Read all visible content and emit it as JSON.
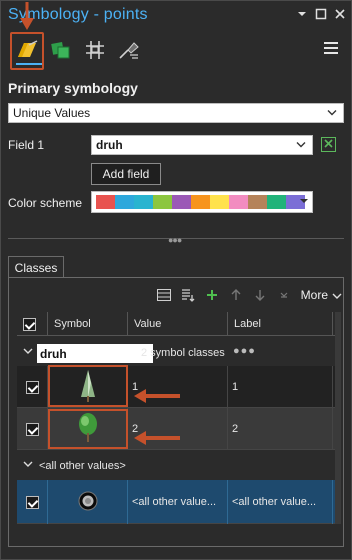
{
  "window": {
    "title": "Symbology - points",
    "buttons": [
      "chevron-down-icon",
      "maximize-icon",
      "close-icon"
    ]
  },
  "tab_icons": [
    {
      "name": "primary-symbology-tab",
      "icon": "paintbrush-icon",
      "active": true
    },
    {
      "name": "vary-symbology-tab",
      "icon": "layers-icon",
      "active": false
    },
    {
      "name": "symbol-layers-tab",
      "icon": "grid-icon",
      "active": false
    },
    {
      "name": "label-classes-tab",
      "icon": "label-icon",
      "active": false
    }
  ],
  "primary": {
    "heading": "Primary symbology",
    "renderer": "Unique Values"
  },
  "field": {
    "label": "Field 1",
    "value": "druh",
    "add_field_label": "Add field"
  },
  "color_scheme": {
    "label": "Color scheme",
    "colors": [
      "#e8534f",
      "#2ea8dc",
      "#29b4d0",
      "#8cc63f",
      "#9b59b6",
      "#f7941d",
      "#ffe24d",
      "#f28cc0",
      "#b5835a",
      "#21b37a",
      "#7b6ed6"
    ]
  },
  "classes_tab": {
    "label": "Classes"
  },
  "toolbar": {
    "more_label": "More"
  },
  "grid": {
    "headers": {
      "symbol": "Symbol",
      "value": "Value",
      "label": "Label"
    },
    "group": {
      "field": "druh",
      "summary": "2 symbol classes",
      "dots": "●●●"
    },
    "rows": [
      {
        "value": "1",
        "label": "1",
        "symbol": "conifer-tree-icon"
      },
      {
        "value": "2",
        "label": "2",
        "symbol": "deciduous-tree-icon"
      }
    ],
    "other_header": "<all other values>",
    "other_row": {
      "value": "<all other value...",
      "label": "<all other value...",
      "symbol": "circle-point-icon"
    }
  },
  "colors": {
    "accent": "#4cb2f5",
    "annotation": "#c5512b",
    "selected_row": "#1e4a6e"
  }
}
